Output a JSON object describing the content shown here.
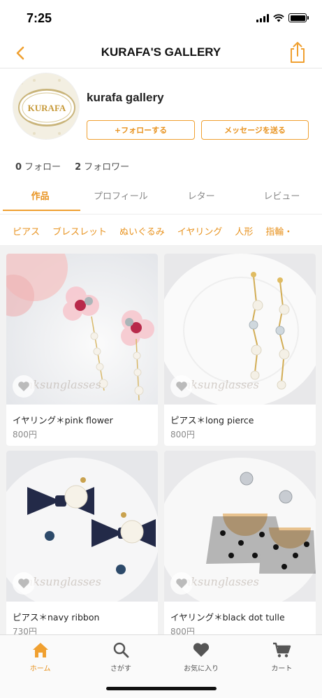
{
  "status": {
    "time": "7:25"
  },
  "nav": {
    "title": "KURAFA'S GALLERY"
  },
  "profile": {
    "avatar_text": "KURAFA",
    "name": "kurafa gallery",
    "follow_label": "+フォローする",
    "message_label": "メッセージを送る",
    "following_count": "0",
    "following_label": "フォロー",
    "followers_count": "2",
    "followers_label": "フォロワー"
  },
  "tabs": [
    {
      "label": "作品",
      "active": true
    },
    {
      "label": "プロフィール",
      "active": false
    },
    {
      "label": "レター",
      "active": false
    },
    {
      "label": "レビュー",
      "active": false
    }
  ],
  "categories": [
    "ピアス",
    "ブレスレット",
    "ぬいぐるみ",
    "イヤリング",
    "人形",
    "指輪・"
  ],
  "products": [
    {
      "title": "イヤリング＊pink flower",
      "price": "800円",
      "watermark": "nksunglasses"
    },
    {
      "title": "ピアス＊long pierce",
      "price": "800円",
      "watermark": "nksunglasses"
    },
    {
      "title": "ピアス＊navy ribbon",
      "price": "730円",
      "watermark": "nksunglasses"
    },
    {
      "title": "イヤリング＊black dot tulle",
      "price": "800円",
      "watermark": "nksunglasses"
    }
  ],
  "tabbar": [
    {
      "label": "ホーム",
      "icon": "home-icon",
      "active": true
    },
    {
      "label": "さがす",
      "icon": "search-icon",
      "active": false
    },
    {
      "label": "お気に入り",
      "icon": "heart-icon",
      "active": false
    },
    {
      "label": "カート",
      "icon": "cart-icon",
      "active": false
    }
  ],
  "colors": {
    "accent": "#f0a030",
    "accent_text": "#e89320"
  }
}
